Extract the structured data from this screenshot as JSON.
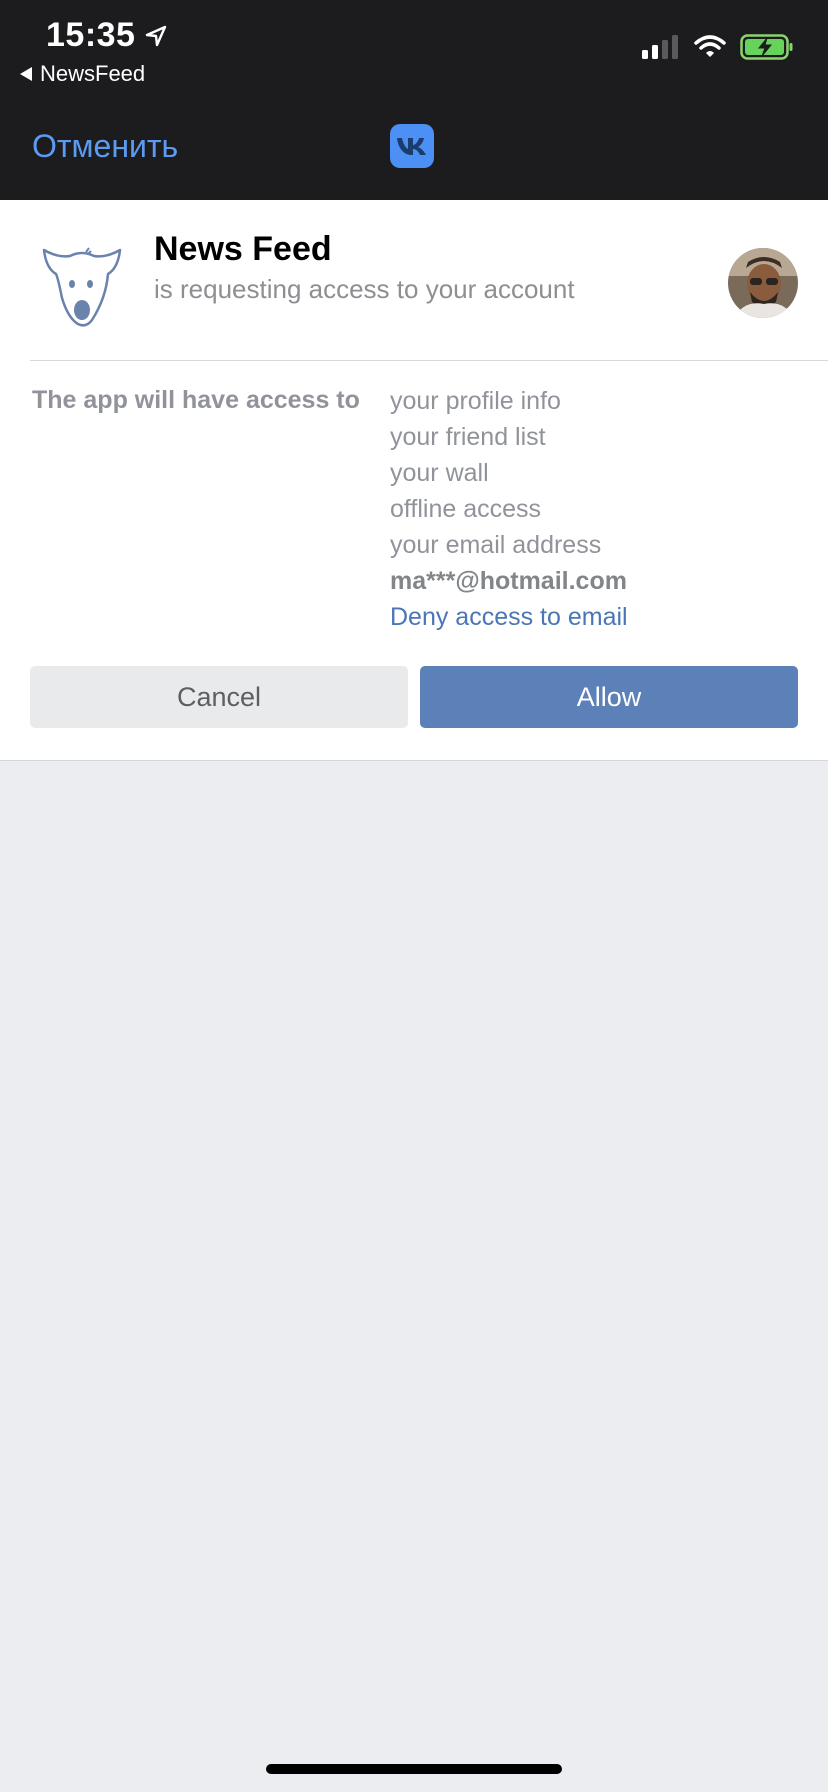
{
  "status_bar": {
    "time": "15:35",
    "back_app": "NewsFeed",
    "icons": [
      "location-arrow-icon",
      "cellular-signal-icon",
      "wifi-icon",
      "battery-charging-icon"
    ]
  },
  "nav": {
    "cancel_label": "Отменить",
    "logo": "vk-logo-icon",
    "accent_color": "#5b9cf2"
  },
  "request": {
    "app_name": "News Feed",
    "subtitle": "is requesting access to your account",
    "access_label": "The app will have access to",
    "permissions": [
      "your profile info",
      "your friend list",
      "your wall",
      "offline access",
      "your email address"
    ],
    "email": "ma***@hotmail.com",
    "deny_email_label": "Deny access to email"
  },
  "actions": {
    "cancel_label": "Cancel",
    "allow_label": "Allow",
    "allow_color": "#5c81b8"
  }
}
